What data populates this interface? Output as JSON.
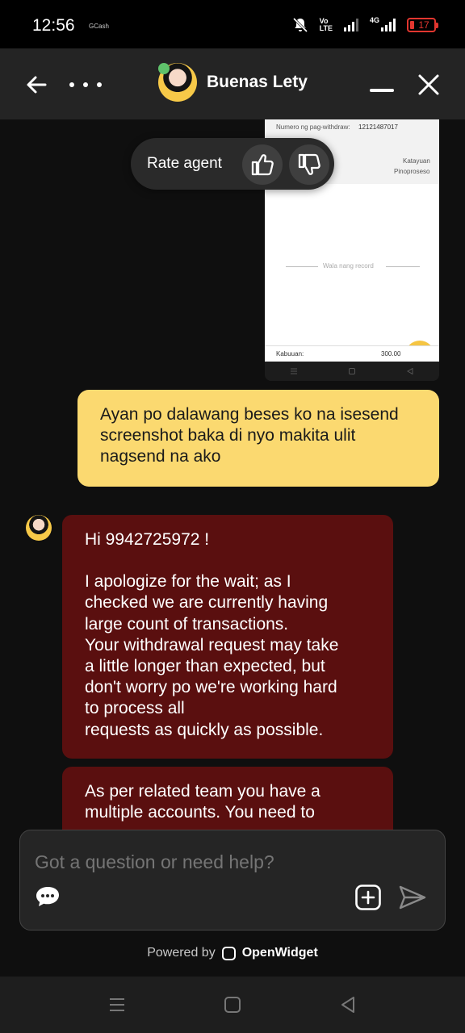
{
  "status_bar": {
    "time": "12:56",
    "app_label": "GCash",
    "network_label": "4G",
    "volte_label_top": "Vo",
    "volte_label_bottom": "LTE",
    "battery": "17",
    "battery_color": "#e2362f"
  },
  "header": {
    "agent_name": "Buenas Lety",
    "online_color": "#5fc26b",
    "icons": [
      "back-arrow-icon",
      "more-icon",
      "minimize-icon",
      "close-icon"
    ]
  },
  "screenshot_attachment": {
    "withdraw_label": "Numero ng pag-withdraw:",
    "withdraw_number": "12121487017",
    "status_label": "Katayuan",
    "status_value": "Pinoproseso",
    "no_record": "Wala nang record",
    "total_label": "Kabuuan:",
    "total_value": "300.00",
    "help_glyph": "?"
  },
  "rating": {
    "label": "Rate agent",
    "up_icon": "thumbs-up-icon",
    "down_icon": "thumbs-down-icon"
  },
  "messages": {
    "user": {
      "lines": [
        "Ayan po dalawang beses ko na isesend",
        "screenshot baka di nyo makita ulit",
        "nagsend na ako"
      ],
      "color": "#fbd970"
    },
    "agent_1": {
      "greeting": "Hi 9942725972 !",
      "lines": [
        "I apologize for the wait; as I",
        "checked we are currently having",
        "large count of transactions.",
        "Your withdrawal request may take",
        "a little longer than expected, but",
        "don't worry po we're working hard",
        "to process all",
        "requests as quickly as possible."
      ],
      "color": "#5a0f0f"
    },
    "agent_2": {
      "lines": [
        "As per related team you have a",
        "multiple accounts. You need to"
      ]
    }
  },
  "composer": {
    "placeholder": "Got a question or need help?",
    "icons": [
      "chat-bubble-icon",
      "attach-plus-icon",
      "send-icon"
    ]
  },
  "footer": {
    "powered_by": "Powered by",
    "brand": "OpenWidget"
  },
  "nav_bar": {
    "icons": [
      "menu-icon",
      "home-square-icon",
      "back-triangle-icon"
    ]
  }
}
